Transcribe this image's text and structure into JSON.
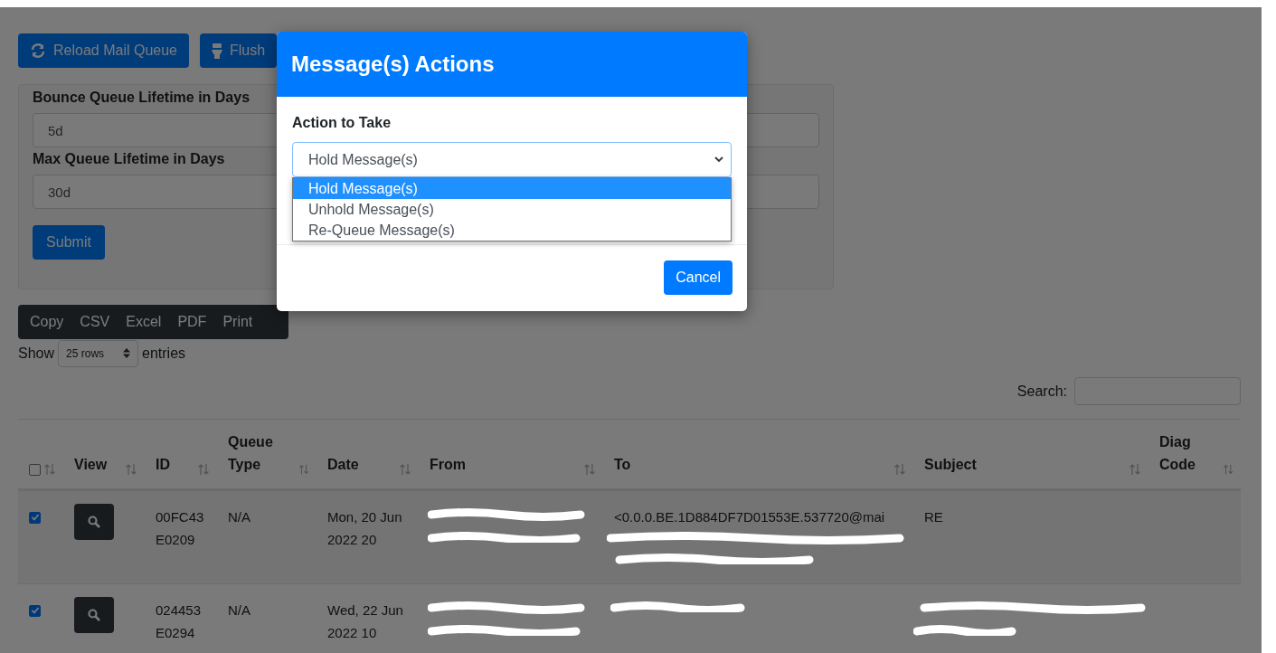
{
  "toolbar": {
    "buttons": [
      {
        "label": "Reload Mail Queue",
        "kind": "reload"
      },
      {
        "label": "Flush",
        "kind": "flush"
      }
    ]
  },
  "settings": {
    "fields": [
      {
        "label": "Bounce Queue Lifetime in Days",
        "value": "5d"
      },
      {
        "label": "Max Queue Lifetime in Days",
        "value": "30d"
      }
    ],
    "submit": "Submit"
  },
  "export_buttons": [
    "Copy",
    "CSV",
    "Excel",
    "PDF",
    "Print"
  ],
  "length": {
    "prefix": "Show",
    "value": "25 rows",
    "suffix": "entries"
  },
  "search": {
    "label": "Search:"
  },
  "table": {
    "select_all": {
      "checked": false
    },
    "columns": [
      "View",
      "ID",
      "Queue Type",
      "Date",
      "From",
      "To",
      "Subject",
      "Diag Code"
    ],
    "rows": [
      {
        "checked": true,
        "id": "00FC43E0209",
        "queue_type": "N/A",
        "date": "Mon, 20 Jun 2022 20",
        "from": {
          "redacted": true
        },
        "to": {
          "text": "<0.0.0.BE.1D884DF7D01553E.537720@mai",
          "redacted": true
        },
        "subject": {
          "text": "RE"
        }
      },
      {
        "checked": true,
        "id": "024453E0294",
        "queue_type": "N/A",
        "date": "Wed, 22 Jun 2022 10",
        "from": {
          "redacted": true
        },
        "to": {
          "redacted": true
        },
        "subject": {
          "redacted": true
        }
      }
    ]
  },
  "modal": {
    "title": "Message(s) Actions",
    "field_label": "Action to Take",
    "select_value": "Hold Message(s)",
    "options": [
      {
        "label": "Hold Message(s)",
        "selected": true
      },
      {
        "label": "Unhold Message(s)",
        "selected": false
      },
      {
        "label": "Re-Queue Message(s)",
        "selected": false
      }
    ],
    "cancel": "Cancel"
  }
}
